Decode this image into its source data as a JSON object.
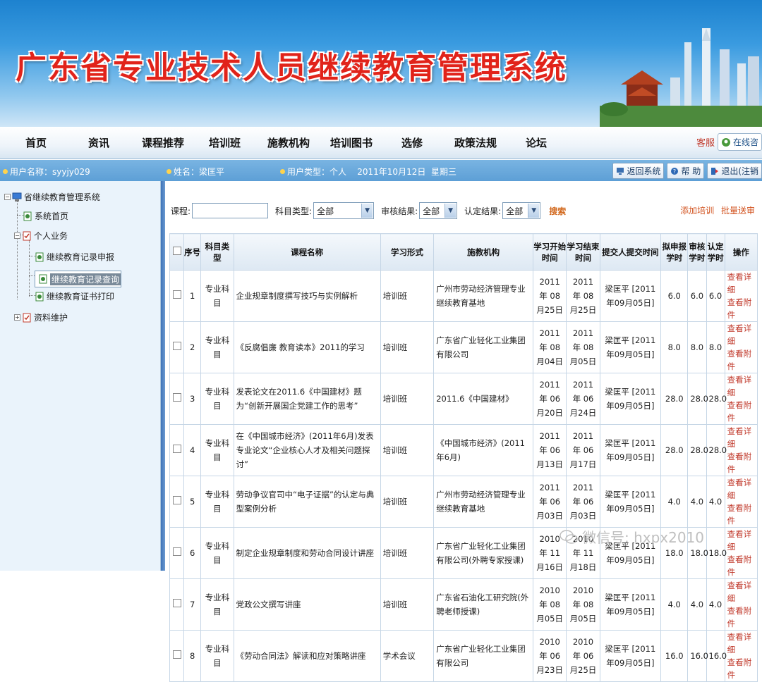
{
  "banner": {
    "title": "广东省专业技术人员继续教育管理系统"
  },
  "nav": {
    "items": [
      "首页",
      "资讯",
      "课程推荐",
      "培训班",
      "施教机构",
      "培训图书",
      "选修",
      "政策法规",
      "论坛"
    ],
    "service_label": "客服",
    "service_button": "在线咨"
  },
  "userbar": {
    "username": "用户名称：syyjy029",
    "name": "姓名：梁匡平",
    "type_date": "用户类型：个人    2011年10月12日  星期三",
    "tools": [
      "返回系统",
      "帮 助",
      "退出(注销"
    ]
  },
  "sidebar": {
    "root": "省继续教育管理系统",
    "home": "系统首页",
    "personal": "个人业务",
    "report": "继续教育记录申报",
    "query": "继续教育记录查询",
    "print": "继续教育证书打印",
    "profile": "资料维护"
  },
  "filter": {
    "course_label": "课程:",
    "subject_label": "科目类型:",
    "subject_value": "全部",
    "audit_label": "审核结果:",
    "audit_value": "全部",
    "certify_label": "认定结果:",
    "certify_value": "全部",
    "search": "搜索",
    "add_training": "添加培训",
    "batch_submit": "批量送审"
  },
  "table": {
    "headers": [
      "序号",
      "科目类型",
      "课程名称",
      "学习形式",
      "施教机构",
      "学习开始时间",
      "学习结束时间",
      "提交人提交时间",
      "拟申报学时",
      "审核学时",
      "认定学时",
      "操作"
    ],
    "rows": [
      {
        "no": "1",
        "type": "专业科目",
        "course": "企业规章制度撰写技巧与实例解析",
        "form": "培训班",
        "org": "广州市劳动经济管理专业继续教育基地",
        "start": "2011年 08月25日",
        "end": "2011年 08月25日",
        "submit": "梁匡平 [2011年09月05日]",
        "h1": "6.0",
        "h2": "6.0",
        "h3": "6.0"
      },
      {
        "no": "2",
        "type": "专业科目",
        "course": "《反腐倡廉 教育读本》2011的学习",
        "form": "培训班",
        "org": "广东省广业轻化工业集团有限公司",
        "start": "2011年 08月04日",
        "end": "2011年 08月05日",
        "submit": "梁匡平 [2011年09月05日]",
        "h1": "8.0",
        "h2": "8.0",
        "h3": "8.0"
      },
      {
        "no": "3",
        "type": "专业科目",
        "course": "发表论文在2011.6《中国建材》题为“创新开展国企党建工作的思考”",
        "form": "培训班",
        "org": "2011.6《中国建材》",
        "start": "2011年 06月20日",
        "end": "2011年 06月24日",
        "submit": "梁匡平 [2011年09月05日]",
        "h1": "28.0",
        "h2": "28.0",
        "h3": "28.0"
      },
      {
        "no": "4",
        "type": "专业科目",
        "course": "在《中国城市经济》(2011年6月)发表专业论文“企业核心人才及相关问题探讨”",
        "form": "培训班",
        "org": "《中国城市经济》(2011年6月)",
        "start": "2011年 06月13日",
        "end": "2011年 06月17日",
        "submit": "梁匡平 [2011年09月05日]",
        "h1": "28.0",
        "h2": "28.0",
        "h3": "28.0"
      },
      {
        "no": "5",
        "type": "专业科目",
        "course": "劳动争议官司中“电子证据”的认定与典型案例分析",
        "form": "培训班",
        "org": "广州市劳动经济管理专业继续教育基地",
        "start": "2011年 06月03日",
        "end": "2011年 06月03日",
        "submit": "梁匡平 [2011年09月05日]",
        "h1": "4.0",
        "h2": "4.0",
        "h3": "4.0"
      },
      {
        "no": "6",
        "type": "专业科目",
        "course": "制定企业规章制度和劳动合同设计讲座",
        "form": "培训班",
        "org": "广东省广业轻化工业集团有限公司(外聘专家授课)",
        "start": "2010年 11月16日",
        "end": "2010年 11月18日",
        "submit": "梁匡平 [2011年09月05日]",
        "h1": "18.0",
        "h2": "18.0",
        "h3": "18.0"
      },
      {
        "no": "7",
        "type": "专业科目",
        "course": "党政公文撰写讲座",
        "form": "培训班",
        "org": "广东省石油化工研究院(外聘老师授课)",
        "start": "2010年 08月05日",
        "end": "2010年 08月05日",
        "submit": "梁匡平 [2011年09月05日]",
        "h1": "4.0",
        "h2": "4.0",
        "h3": "4.0"
      },
      {
        "no": "8",
        "type": "专业科目",
        "course": "《劳动合同法》解读和应对策略讲座",
        "form": "学术会议",
        "org": "广东省广业轻化工业集团有限公司",
        "start": "2010年 06月23日",
        "end": "2010年 06月25日",
        "submit": "梁匡平 [2011年09月05日]",
        "h1": "16.0",
        "h2": "16.0",
        "h3": "16.0"
      }
    ],
    "op_detail": "查看详细",
    "op_attach": "查看附件"
  },
  "watermark": "微信号: hxpx2010",
  "colors": {
    "title_red": "#e1231a",
    "link_red": "#c0392b",
    "userbar_blue": "#5d9fd6"
  }
}
